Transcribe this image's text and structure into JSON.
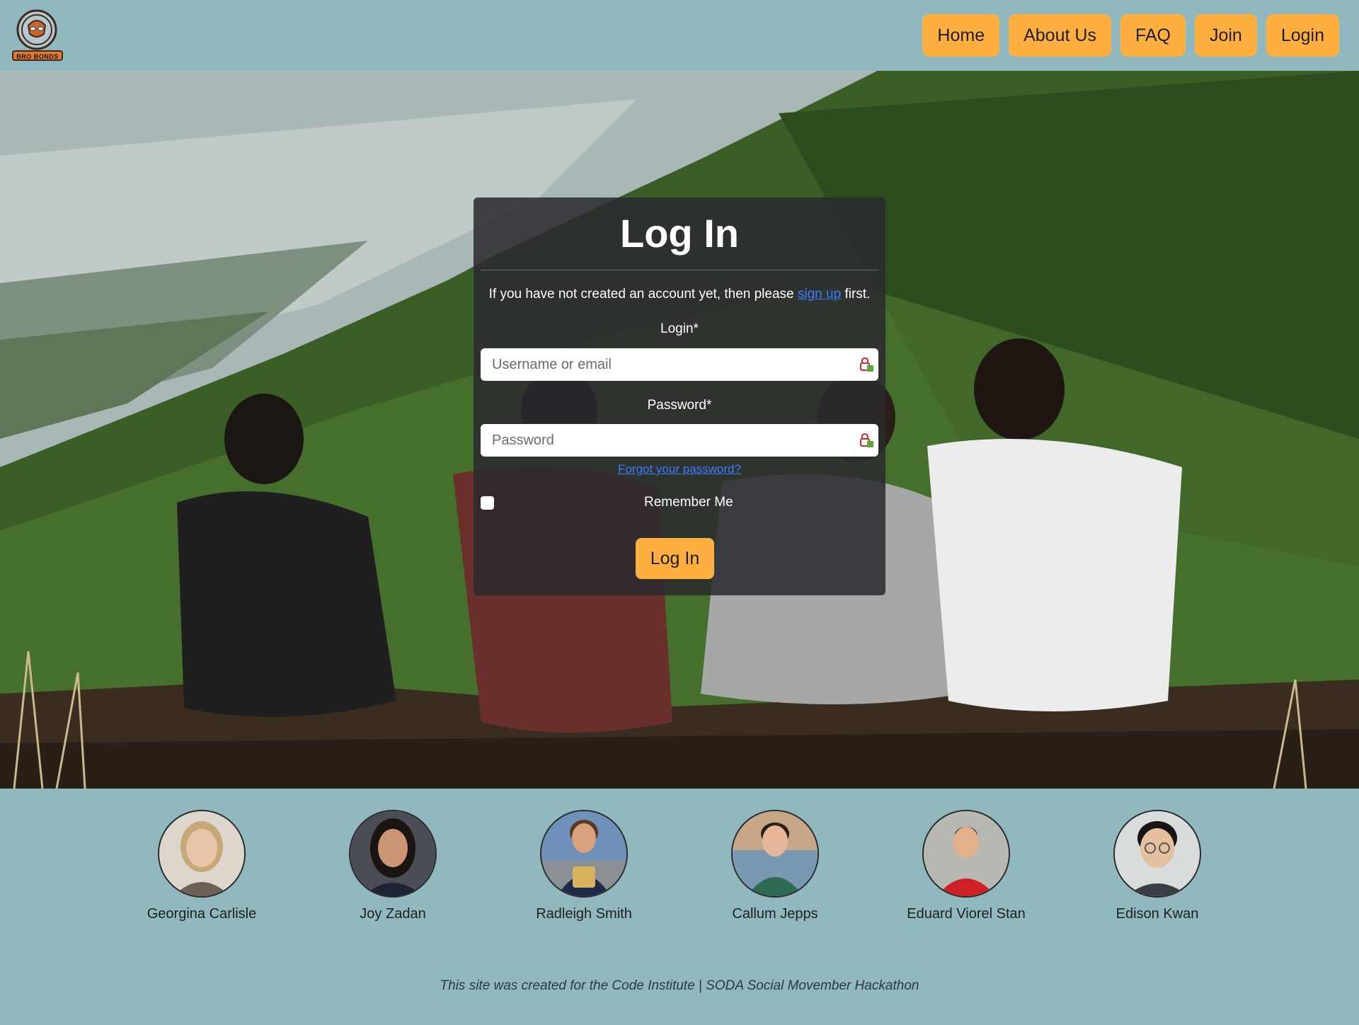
{
  "brand": {
    "logo_text": "BRO BONDS"
  },
  "nav": {
    "items": [
      {
        "label": "Home"
      },
      {
        "label": "About Us"
      },
      {
        "label": "FAQ"
      },
      {
        "label": "Join"
      },
      {
        "label": "Login"
      }
    ]
  },
  "login": {
    "title": "Log In",
    "intro_before": "If you have not created an account yet, then please ",
    "intro_link": "sign up",
    "intro_after": " first.",
    "login_label": "Login*",
    "login_placeholder": "Username or email",
    "password_label": "Password*",
    "password_placeholder": "Password",
    "forgot_link": "Forgot your password?",
    "remember_label": "Remember Me",
    "remember_checked": false,
    "submit_label": "Log In"
  },
  "team": [
    {
      "name": "Georgina Carlisle",
      "skin": "#e8c4a8",
      "hair": "#c9a877",
      "shirt": "#6d6058",
      "bg": "#ddd6cc"
    },
    {
      "name": "Joy Zadan",
      "skin": "#c99574",
      "hair": "#1b1512",
      "shirt": "#1d2535",
      "bg": "#4a4d56"
    },
    {
      "name": "Radleigh Smith",
      "skin": "#d9a27e",
      "hair": "#5a3a24",
      "shirt": "#1f2a4a",
      "bg": "#6f90b8"
    },
    {
      "name": "Callum Jepps",
      "skin": "#e6b899",
      "hair": "#2b1f18",
      "shirt": "#2f6a54",
      "bg": "#c8a789"
    },
    {
      "name": "Eduard Viorel Stan",
      "skin": "#e3b08c",
      "hair": "#3a2a20",
      "shirt": "#d01f27",
      "bg": "#b8b8b2"
    },
    {
      "name": "Edison Kwan",
      "skin": "#e4c09f",
      "hair": "#161414",
      "shirt": "#3b3e45",
      "bg": "#d9dcdc"
    }
  ],
  "footer": {
    "text": "This site was created for the Code Institute | SODA Social Movember Hackathon"
  },
  "colors": {
    "accent": "#ffaf3f",
    "background": "#91b7bf",
    "card": "#2a2a2e",
    "link": "#3d7bff"
  }
}
